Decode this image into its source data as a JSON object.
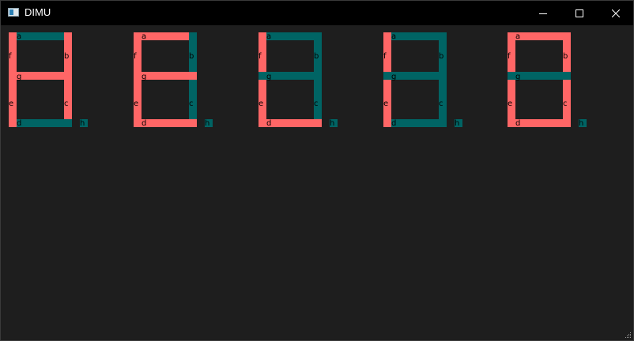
{
  "window": {
    "title": "DIMU",
    "app_icon": "app-window-icon"
  },
  "controls": {
    "minimize_icon": "minimize-icon",
    "maximize_icon": "maximize-icon",
    "close_icon": "close-icon"
  },
  "colors": {
    "on": "#ff6666",
    "off": "#006464",
    "background": "#1e1e1e",
    "titlebar": "#000000"
  },
  "segment_labels": [
    "a",
    "b",
    "c",
    "d",
    "e",
    "f",
    "g",
    "h"
  ],
  "digits": [
    {
      "segments": {
        "a": "off",
        "b": "on",
        "c": "on",
        "d": "off",
        "e": "on",
        "f": "on",
        "g": "on",
        "h": "off"
      }
    },
    {
      "segments": {
        "a": "on",
        "b": "off",
        "c": "off",
        "d": "on",
        "e": "on",
        "f": "on",
        "g": "on",
        "h": "off"
      }
    },
    {
      "segments": {
        "a": "off",
        "b": "off",
        "c": "off",
        "d": "on",
        "e": "on",
        "f": "on",
        "g": "off",
        "h": "off"
      }
    },
    {
      "segments": {
        "a": "off",
        "b": "off",
        "c": "off",
        "d": "off",
        "e": "on",
        "f": "on",
        "g": "off",
        "h": "off"
      }
    },
    {
      "segments": {
        "a": "on",
        "b": "on",
        "c": "on",
        "d": "on",
        "e": "on",
        "f": "on",
        "g": "off",
        "h": "off"
      }
    }
  ]
}
